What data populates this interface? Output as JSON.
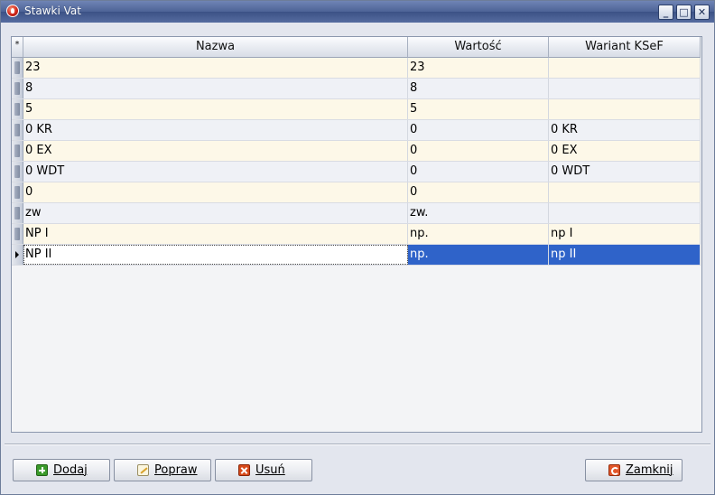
{
  "window": {
    "title": "Stawki Vat",
    "controls": {
      "minimize": "_",
      "maximize": "□",
      "close": "✕"
    }
  },
  "grid": {
    "header_indicator": "*",
    "columns": [
      "Nazwa",
      "Wartość",
      "Wariant KSeF"
    ],
    "rows": [
      [
        "23",
        "23",
        ""
      ],
      [
        "8",
        "8",
        ""
      ],
      [
        "5",
        "5",
        ""
      ],
      [
        "0 KR",
        "0",
        "0 KR"
      ],
      [
        "0 EX",
        "0",
        "0 EX"
      ],
      [
        "0 WDT",
        "0",
        "0 WDT"
      ],
      [
        "0",
        "0",
        ""
      ],
      [
        "zw",
        "zw.",
        ""
      ],
      [
        "NP I",
        "np.",
        "np I"
      ],
      [
        "NP II",
        "np.",
        "np II"
      ]
    ],
    "selected_row": 9
  },
  "buttons": {
    "dodaj": "Dodaj",
    "popraw": "Popraw",
    "usun": "Usuń",
    "zamknij": "Zamknij"
  },
  "icons": {
    "app": "vat-app-icon",
    "dodaj": "plus-icon",
    "popraw": "edit-icon",
    "usun": "delete-icon",
    "zamknij": "close-door-icon"
  },
  "colors": {
    "selection": "#2f63c9",
    "row_alt_a": "#fdf8e8",
    "row_alt_b": "#eff1f6",
    "titlebar": "#4d6396"
  }
}
